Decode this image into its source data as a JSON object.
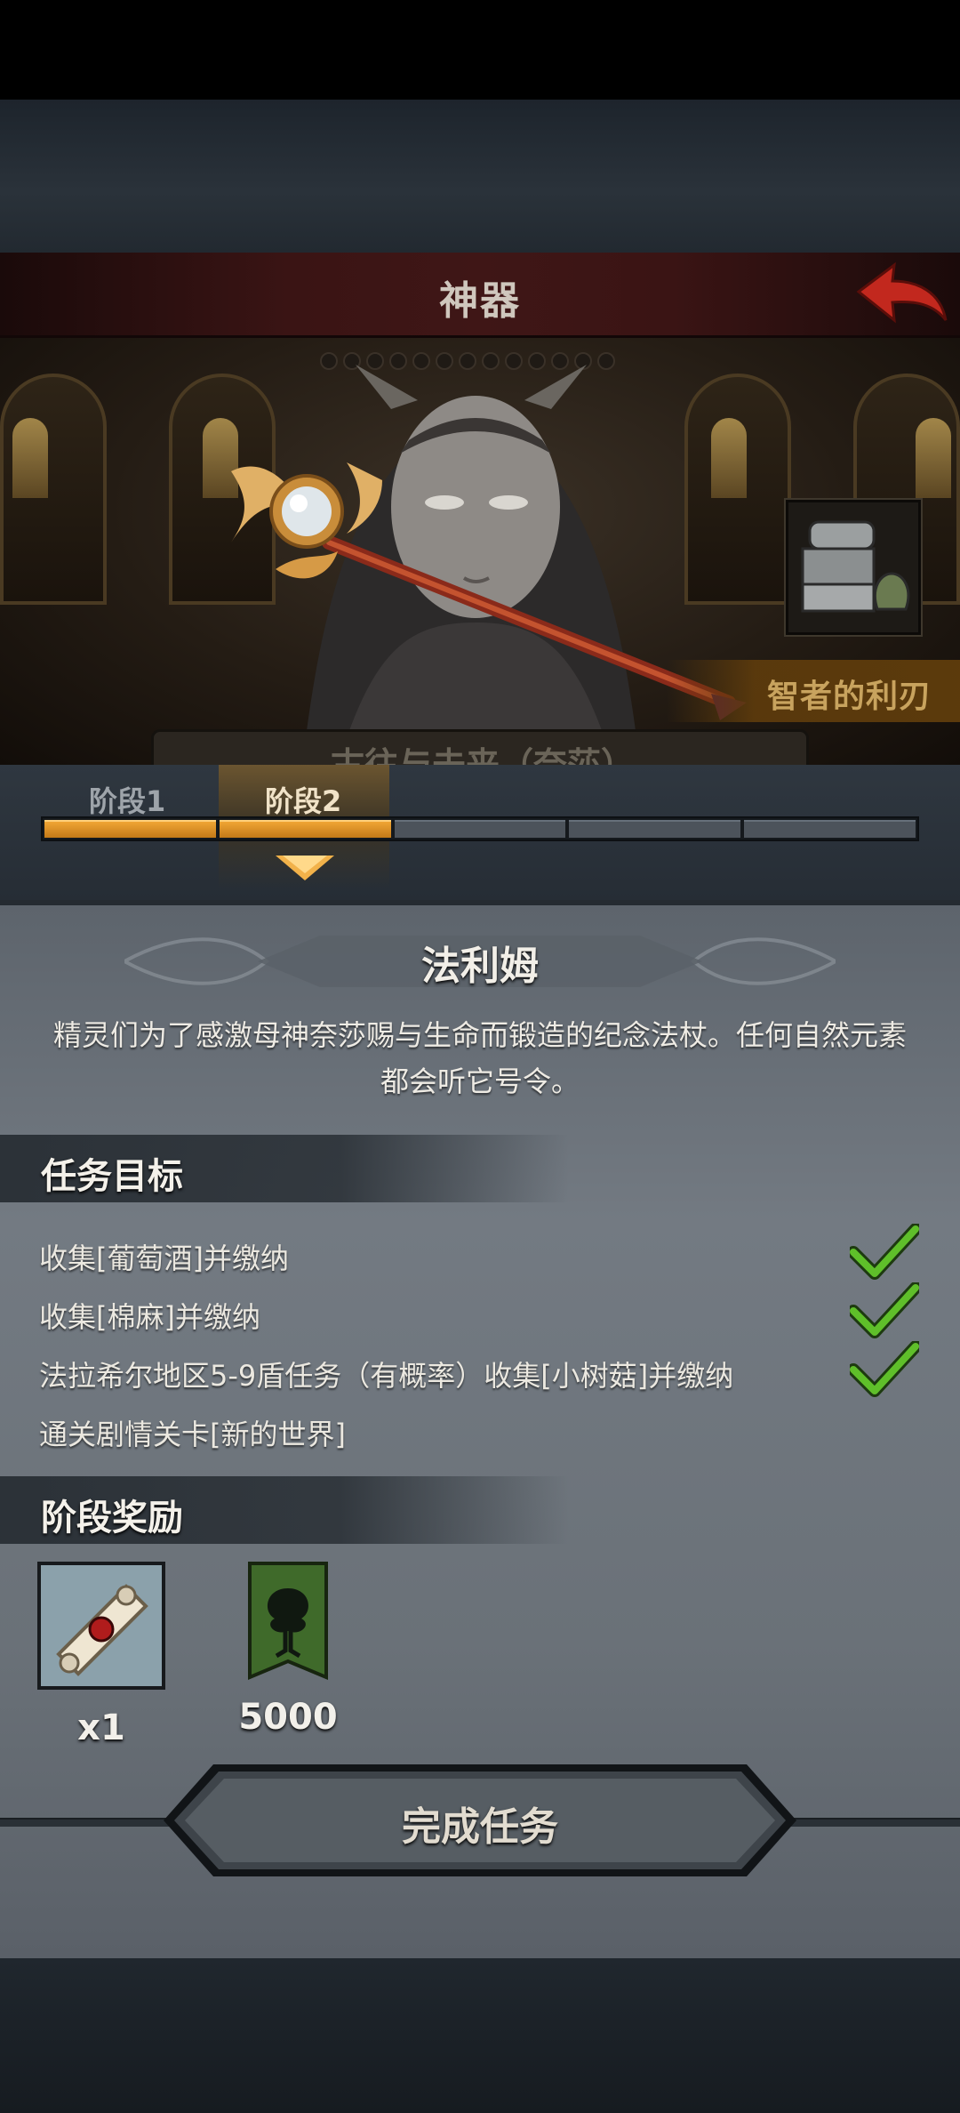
{
  "header": {
    "title": "神器"
  },
  "hero": {
    "artifact_card_label": "智者的利刃",
    "banner_text": "古往与未来（奈莎）"
  },
  "stages": {
    "tabs": [
      {
        "label": "阶段1"
      },
      {
        "label": "阶段2"
      }
    ],
    "active_index": 1,
    "segments_total": 5,
    "segments_done": 2
  },
  "artifact": {
    "name": "法利姆",
    "description": "精灵们为了感激母神奈莎赐与生命而锻造的纪念法杖。任何自然元素都会听它号令。"
  },
  "tasks": {
    "title": "任务目标",
    "items": [
      {
        "text": "收集[葡萄酒]并缴纳",
        "done": true
      },
      {
        "text": "收集[棉麻]并缴纳",
        "done": true
      },
      {
        "text": "法拉希尔地区5-9盾任务（有概率）收集[小树菇]并缴纳",
        "done": true
      },
      {
        "text": "通关剧情关卡[新的世界]",
        "done": false
      }
    ]
  },
  "rewards": {
    "title": "阶段奖励",
    "items": [
      {
        "icon": "scroll-icon",
        "count": "x1"
      },
      {
        "icon": "tree-banner-icon",
        "count": "5000"
      }
    ]
  },
  "actions": {
    "complete_label": "完成任务"
  },
  "colors": {
    "accent": "#e9a232",
    "check": "#5fbf2a",
    "title_bar": "#3f1616",
    "back_arrow": "#c2281e"
  }
}
